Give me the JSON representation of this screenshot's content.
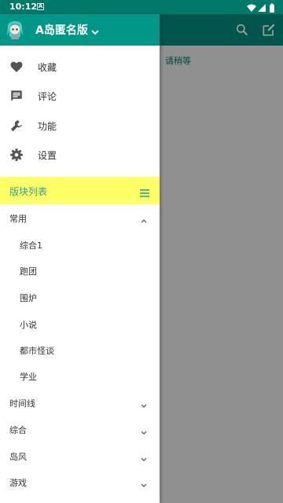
{
  "status_bar": {
    "time": "10:12",
    "notification_badge": "A"
  },
  "background": {
    "waiting_text": "请稍等",
    "actions": [
      {
        "icon": "search-icon"
      },
      {
        "icon": "edit-icon"
      }
    ],
    "toolbar_color": "#00897b"
  },
  "drawer": {
    "app_title": "A岛匿名版",
    "header_color": "#009688",
    "menu": [
      {
        "icon": "heart-icon",
        "label": "收藏"
      },
      {
        "icon": "comment-icon",
        "label": "评论"
      },
      {
        "icon": "wrench-icon",
        "label": "功能"
      },
      {
        "icon": "gear-icon",
        "label": "设置"
      }
    ],
    "board_list": {
      "title": "版块列表",
      "highlight_color": "#ffff66"
    },
    "categories": [
      {
        "label": "常用",
        "expanded": true,
        "boards": [
          "综合1",
          "跑团",
          "围炉",
          "小说",
          "都市怪谈",
          "学业"
        ]
      },
      {
        "label": "时间线",
        "expanded": false
      },
      {
        "label": "综合",
        "expanded": false
      },
      {
        "label": "岛风",
        "expanded": false
      },
      {
        "label": "游戏",
        "expanded": false
      }
    ]
  }
}
